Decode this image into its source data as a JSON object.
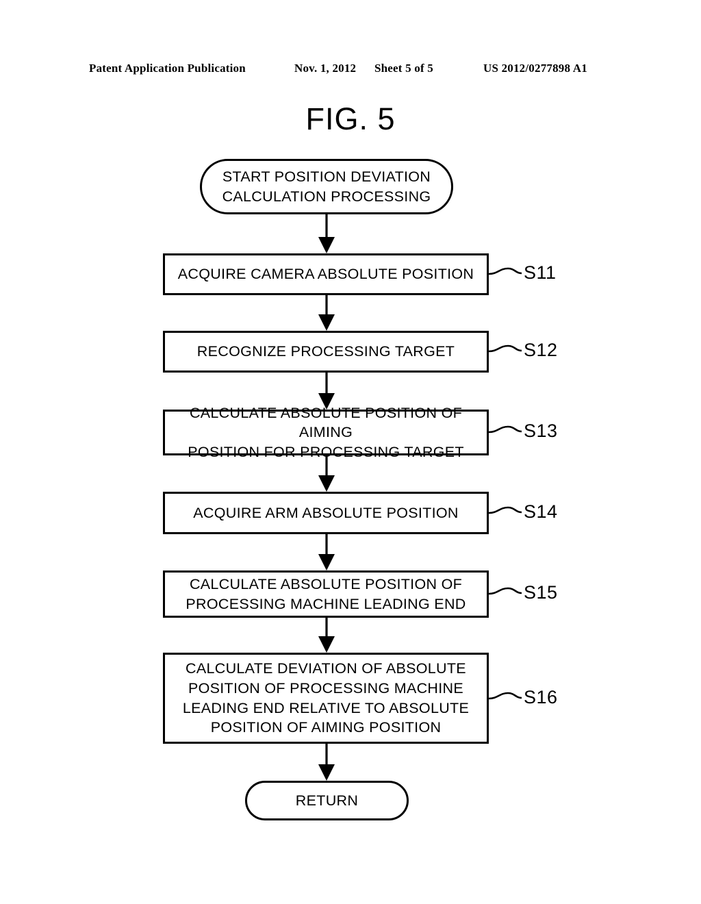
{
  "header": {
    "publication": "Patent Application Publication",
    "date": "Nov. 1, 2012",
    "sheet": "Sheet 5 of 5",
    "patent_number": "US 2012/0277898 A1"
  },
  "figure": {
    "title": "FIG. 5"
  },
  "flowchart": {
    "type": "flowchart",
    "orientation": "top-to-bottom",
    "nodes": [
      {
        "id": "start",
        "shape": "terminal",
        "text": "START POSITION DEVIATION\nCALCULATION PROCESSING",
        "step": ""
      },
      {
        "id": "s11",
        "shape": "process",
        "text": "ACQUIRE CAMERA ABSOLUTE POSITION",
        "step": "S11"
      },
      {
        "id": "s12",
        "shape": "process",
        "text": "RECOGNIZE PROCESSING TARGET",
        "step": "S12"
      },
      {
        "id": "s13",
        "shape": "process",
        "text": "CALCULATE ABSOLUTE POSITION OF AIMING\nPOSITION FOR PROCESSING TARGET",
        "step": "S13"
      },
      {
        "id": "s14",
        "shape": "process",
        "text": "ACQUIRE ARM ABSOLUTE POSITION",
        "step": "S14"
      },
      {
        "id": "s15",
        "shape": "process",
        "text": "CALCULATE ABSOLUTE POSITION OF\nPROCESSING MACHINE LEADING END",
        "step": "S15"
      },
      {
        "id": "s16",
        "shape": "process",
        "text": "CALCULATE DEVIATION OF ABSOLUTE\nPOSITION OF PROCESSING MACHINE\nLEADING END RELATIVE TO ABSOLUTE\nPOSITION OF AIMING POSITION",
        "step": "S16"
      },
      {
        "id": "return",
        "shape": "terminal",
        "text": "RETURN",
        "step": ""
      }
    ],
    "edges": [
      {
        "from": "start",
        "to": "s11",
        "arrow": "down"
      },
      {
        "from": "s11",
        "to": "s12",
        "arrow": "down"
      },
      {
        "from": "s12",
        "to": "s13",
        "arrow": "down"
      },
      {
        "from": "s13",
        "to": "s14",
        "arrow": "down"
      },
      {
        "from": "s14",
        "to": "s15",
        "arrow": "down"
      },
      {
        "from": "s15",
        "to": "s16",
        "arrow": "down"
      },
      {
        "from": "s16",
        "to": "return",
        "arrow": "down"
      }
    ]
  },
  "colors": {
    "ink": "#000000",
    "paper": "#ffffff"
  }
}
